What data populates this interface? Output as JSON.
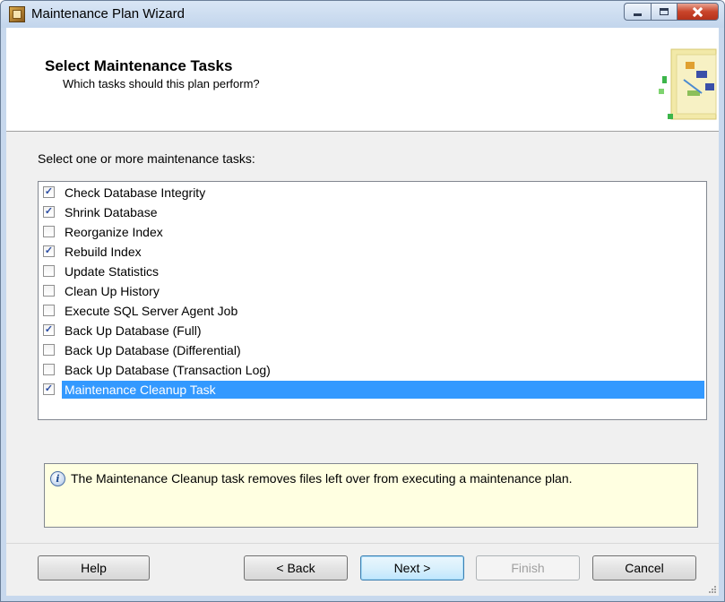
{
  "window": {
    "title": "Maintenance Plan Wizard"
  },
  "header": {
    "title": "Select Maintenance Tasks",
    "subtitle": "Which tasks should this plan perform?"
  },
  "task_list": {
    "label": "Select one or more maintenance tasks:",
    "items": [
      {
        "label": "Check Database Integrity",
        "checked": true,
        "selected": false
      },
      {
        "label": "Shrink Database",
        "checked": true,
        "selected": false
      },
      {
        "label": "Reorganize Index",
        "checked": false,
        "selected": false
      },
      {
        "label": "Rebuild Index",
        "checked": true,
        "selected": false
      },
      {
        "label": "Update Statistics",
        "checked": false,
        "selected": false
      },
      {
        "label": "Clean Up History",
        "checked": false,
        "selected": false
      },
      {
        "label": "Execute SQL Server Agent Job",
        "checked": false,
        "selected": false
      },
      {
        "label": "Back Up Database (Full)",
        "checked": true,
        "selected": false
      },
      {
        "label": "Back Up Database (Differential)",
        "checked": false,
        "selected": false
      },
      {
        "label": "Back Up Database (Transaction Log)",
        "checked": false,
        "selected": false
      },
      {
        "label": "Maintenance Cleanup Task",
        "checked": true,
        "selected": true
      }
    ]
  },
  "info": {
    "icon": "info-icon",
    "text": "The Maintenance Cleanup task removes files left over from executing a maintenance plan."
  },
  "buttons": {
    "help": "Help",
    "back": "< Back",
    "next": "Next >",
    "finish": "Finish",
    "cancel": "Cancel"
  },
  "colors": {
    "selection": "#3399ff",
    "info_background": "#ffffe1",
    "checkmark": "#2a4ca3"
  }
}
